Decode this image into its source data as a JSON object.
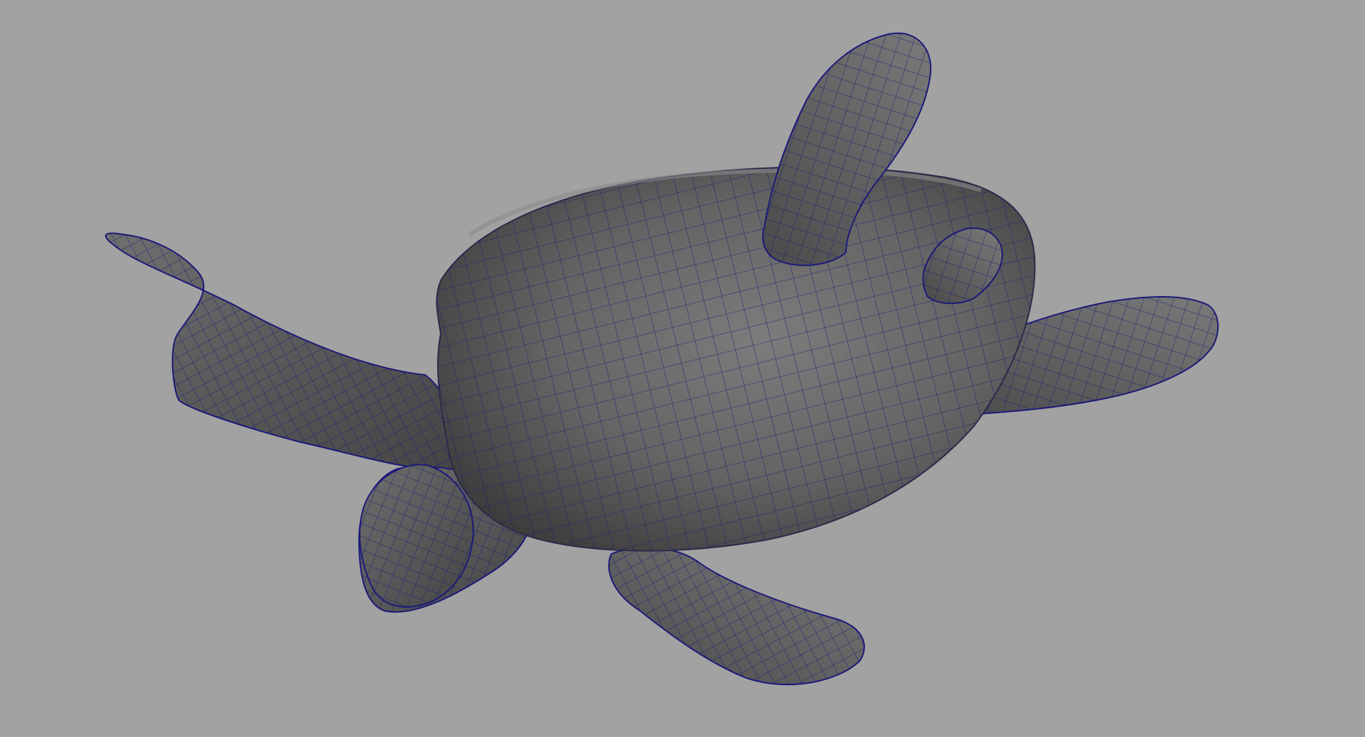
{
  "viewport": {
    "background_color": "#a2a2a2",
    "model": {
      "name": "sea-turtle-mesh",
      "shading": "smooth-shaded-with-wireframe",
      "surface_color": "#5e5e5e",
      "wireframe_color": "#1c1a78"
    }
  }
}
